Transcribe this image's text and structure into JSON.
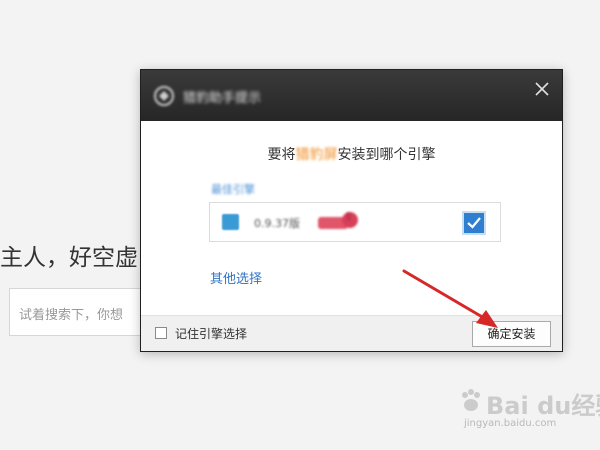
{
  "background": {
    "greeting": "主人，好空虚",
    "search_placeholder": "试着搜索下，你想"
  },
  "dialog": {
    "title": "猎豹助手提示",
    "question_prefix": "要将",
    "question_highlight": "猎豹屏",
    "question_suffix": "安装到哪个引擎",
    "recommend_label": "最佳引擎",
    "engine_version": "0.9.37版",
    "other_options": "其他选择",
    "remember_label": "记住引擎选择",
    "confirm_label": "确定安装"
  },
  "watermark": {
    "brand": "Bai du经验",
    "url": "jingyan.baidu.com"
  },
  "colors": {
    "titlebar": "#2e2e2e",
    "accent": "#2f7fd0",
    "highlight": "#f08a1c",
    "arrow": "#d62828"
  }
}
